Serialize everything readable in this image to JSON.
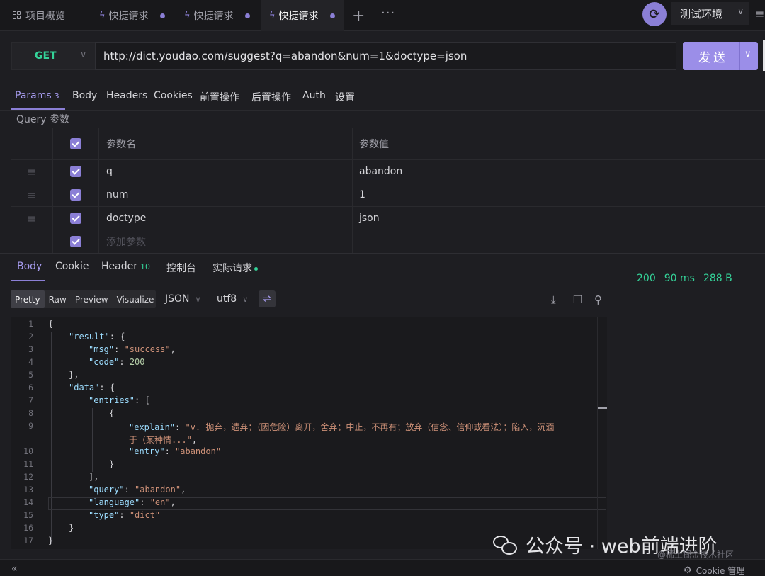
{
  "tabs": {
    "overview": "项目概览",
    "items": [
      "快捷请求",
      "快捷请求",
      "快捷请求"
    ],
    "active_index": 2,
    "add": "+",
    "more": "···"
  },
  "env": {
    "label": "测试环境"
  },
  "request": {
    "method": "GET",
    "url": "http://dict.youdao.com/suggest?q=abandon&num=1&doctype=json",
    "send": "发送"
  },
  "req_tabs": {
    "params": "Params",
    "params_count": "3",
    "body": "Body",
    "headers": "Headers",
    "cookies": "Cookies",
    "pre": "前置操作",
    "post": "后置操作",
    "auth": "Auth",
    "settings": "设置"
  },
  "query_label": "Query 参数",
  "params_table": {
    "header_name": "参数名",
    "header_value": "参数值",
    "rows": [
      {
        "name": "q",
        "value": "abandon"
      },
      {
        "name": "num",
        "value": "1"
      },
      {
        "name": "doctype",
        "value": "json"
      }
    ],
    "add_placeholder": "添加参数"
  },
  "res_tabs": {
    "body": "Body",
    "cookie": "Cookie",
    "header": "Header",
    "header_count": "10",
    "console": "控制台",
    "actual": "实际请求"
  },
  "status": {
    "code": "200",
    "time": "90 ms",
    "size": "288 B"
  },
  "viewer": {
    "modes": [
      "Pretty",
      "Raw",
      "Preview",
      "Visualize"
    ],
    "active_mode": "Pretty",
    "format": "JSON",
    "encoding": "utf8"
  },
  "code": {
    "line_numbers": [
      "1",
      "2",
      "3",
      "4",
      "5",
      "6",
      "7",
      "8",
      "9",
      "",
      "10",
      "11",
      "12",
      "13",
      "14",
      "15",
      "16",
      "17"
    ],
    "t": {
      "l1": "{",
      "k_result": "\"result\"",
      "p_open_obj": ": {",
      "k_msg": "\"msg\"",
      "colon": ": ",
      "v_success": "\"success\"",
      "comma": ",",
      "k_code": "\"code\"",
      "v_200": "200",
      "close_obj_comma": "},",
      "k_data": "\"data\"",
      "k_entries": "\"entries\"",
      "p_open_arr": ": [",
      "open_obj": "{",
      "k_explain": "\"explain\"",
      "v_explain_1": "\"v. 抛弃，遗弃；（因危险）离开，舍弃；中止，不再有；放弃（信念、信仰或看法）；陷入，沉湎",
      "v_explain_2": "于（某种情...\"",
      "k_entry": "\"entry\"",
      "v_abandon": "\"abandon\"",
      "close_obj": "}",
      "close_arr_comma": "],",
      "k_query": "\"query\"",
      "k_language": "\"language\"",
      "v_en": "\"en\"",
      "k_type": "\"type\"",
      "v_dict": "\"dict\""
    }
  },
  "bottom": {
    "collapse": "«",
    "cookie_manager": "Cookie 管理"
  },
  "watermark": {
    "main": "公众号 · web前端进阶",
    "small": "@稀土掘金技术社区"
  }
}
